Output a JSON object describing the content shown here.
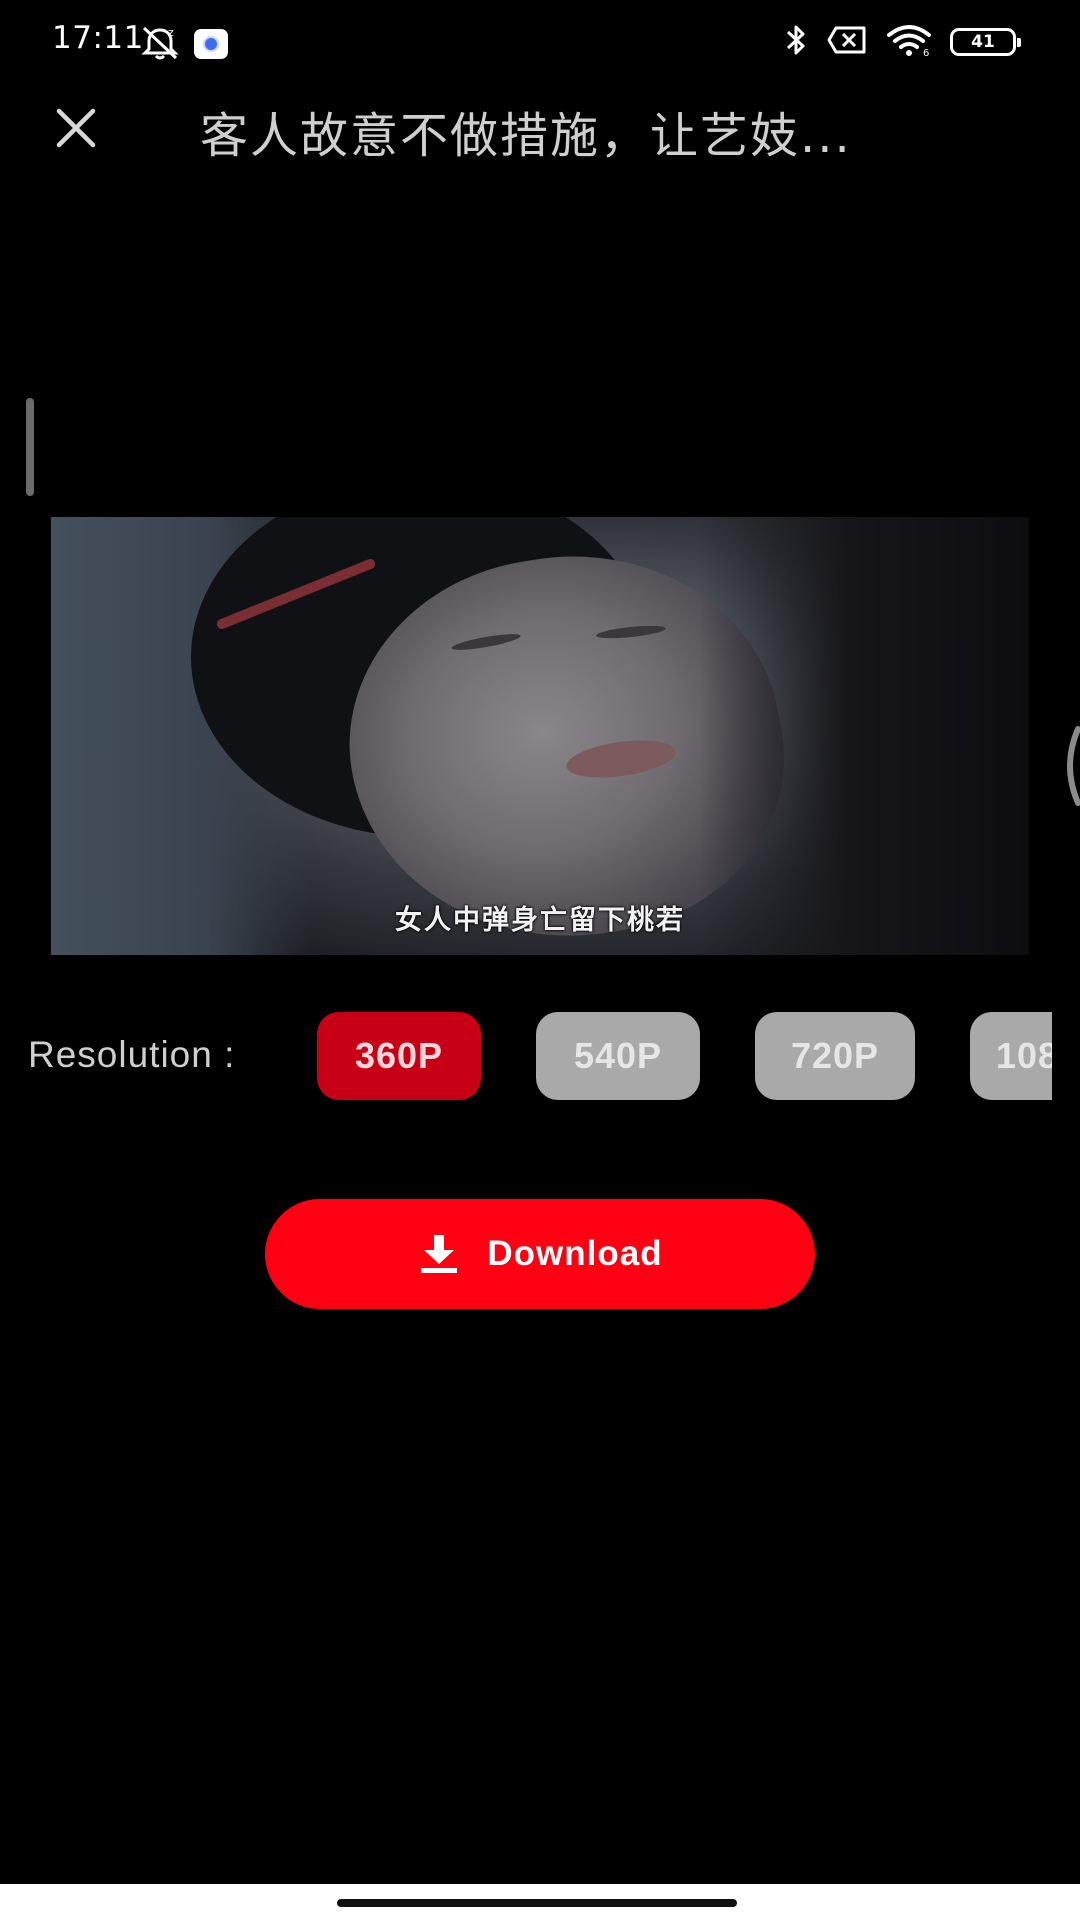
{
  "status_bar": {
    "time": "17:11",
    "battery_level": "41",
    "icons": [
      "alarm-off-icon",
      "app-notification-icon",
      "bluetooth-icon",
      "sim-off-icon",
      "wifi-icon",
      "battery-icon"
    ]
  },
  "header": {
    "close_icon": "close-icon",
    "title": "客人故意不做措施，让艺妓..."
  },
  "video": {
    "subtitle": "女人中弹身亡留下桃若"
  },
  "resolution": {
    "label": "Resolution :",
    "options": [
      "360P",
      "540P",
      "720P",
      "108"
    ],
    "selected": "360P"
  },
  "download": {
    "icon": "download-icon",
    "label": "Download"
  },
  "colors": {
    "background": "#000000",
    "accent": "#ff0012",
    "selected_option": "#c70016",
    "unselected_option": "#a9a9a9"
  }
}
